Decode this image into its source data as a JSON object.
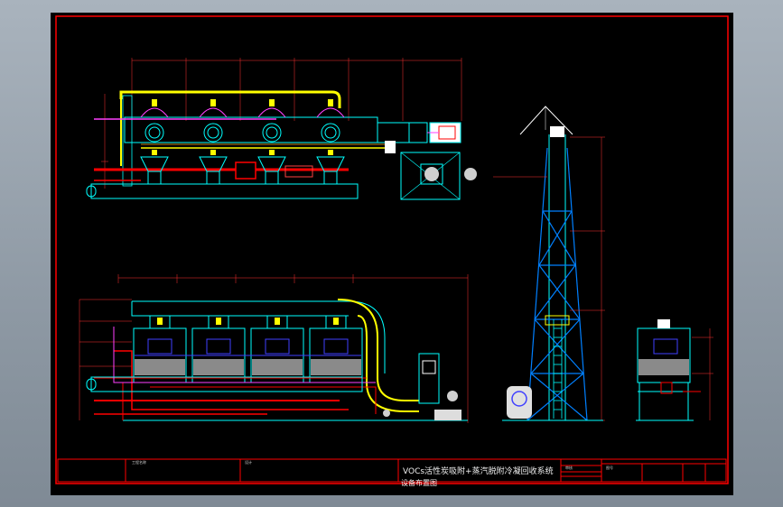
{
  "drawing": {
    "project_name": "VOCs活性炭吸附+蒸汽脱附冷凝回收系统",
    "drawing_title": "设备布置图",
    "project_label": "工程名称",
    "design_label": "设计",
    "check_label": "审核",
    "drawing_no_label": "图号"
  },
  "colors": {
    "sheet_background": "#000000",
    "frame": "#ff0000",
    "equipment_outline": "#00ffff",
    "steam_pipe": "#ff0000",
    "exhaust_duct": "#ffff00",
    "valves": "#ffff00",
    "carbon_bed": "#8a8a8a",
    "dimension_lines": "#ff3030"
  },
  "views": [
    {
      "name": "plan-view",
      "description": "top view of adsorption towers and piping"
    },
    {
      "name": "front-elevation",
      "description": "front view of four adsorbers with exhaust duct"
    },
    {
      "name": "chimney-elevation",
      "description": "exhaust stack with ladder"
    },
    {
      "name": "side-elevation",
      "description": "side view of adsorber"
    }
  ]
}
